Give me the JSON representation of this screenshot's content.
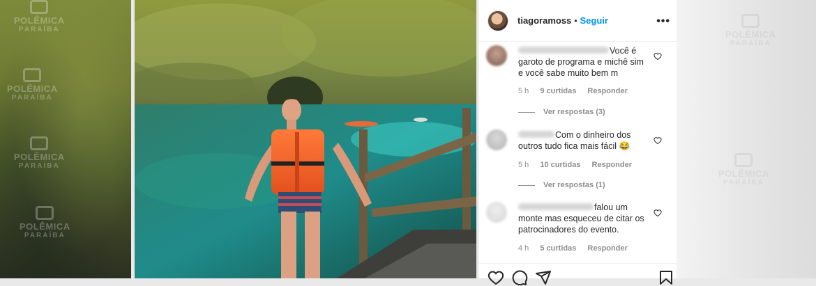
{
  "watermark": {
    "brand_line1": "POLÊMICA",
    "brand_line2": "PARAÍBA"
  },
  "post": {
    "username": "tiagoramoss",
    "separator": "•",
    "follow_label": "Seguir",
    "more_icon": "more-horizontal-icon",
    "more_glyph": "•••"
  },
  "comments": [
    {
      "text_fragment": "Você é garoto de programa e michê sim e você sabe muito bem m",
      "time": "5 h",
      "likes": "9 curtidas",
      "reply_label": "Responder",
      "view_replies": "Ver respostas (3)"
    },
    {
      "text_fragment": "Com o dinheiro dos outros tudo fica mais fácil 😂",
      "time": "5 h",
      "likes": "10 curtidas",
      "reply_label": "Responder",
      "view_replies": "Ver respostas (1)"
    },
    {
      "text_fragment": "falou um monte mas esqueceu de citar os patrocinadores do evento.",
      "time": "4 h",
      "likes": "5 curtidas",
      "reply_label": "Responder"
    }
  ],
  "actions": {
    "like_icon": "heart-icon",
    "comment_icon": "comment-icon",
    "share_icon": "send-icon",
    "save_icon": "bookmark-icon"
  },
  "colors": {
    "accent": "#0095f6",
    "text": "#262626",
    "muted": "#8e8e8e"
  }
}
